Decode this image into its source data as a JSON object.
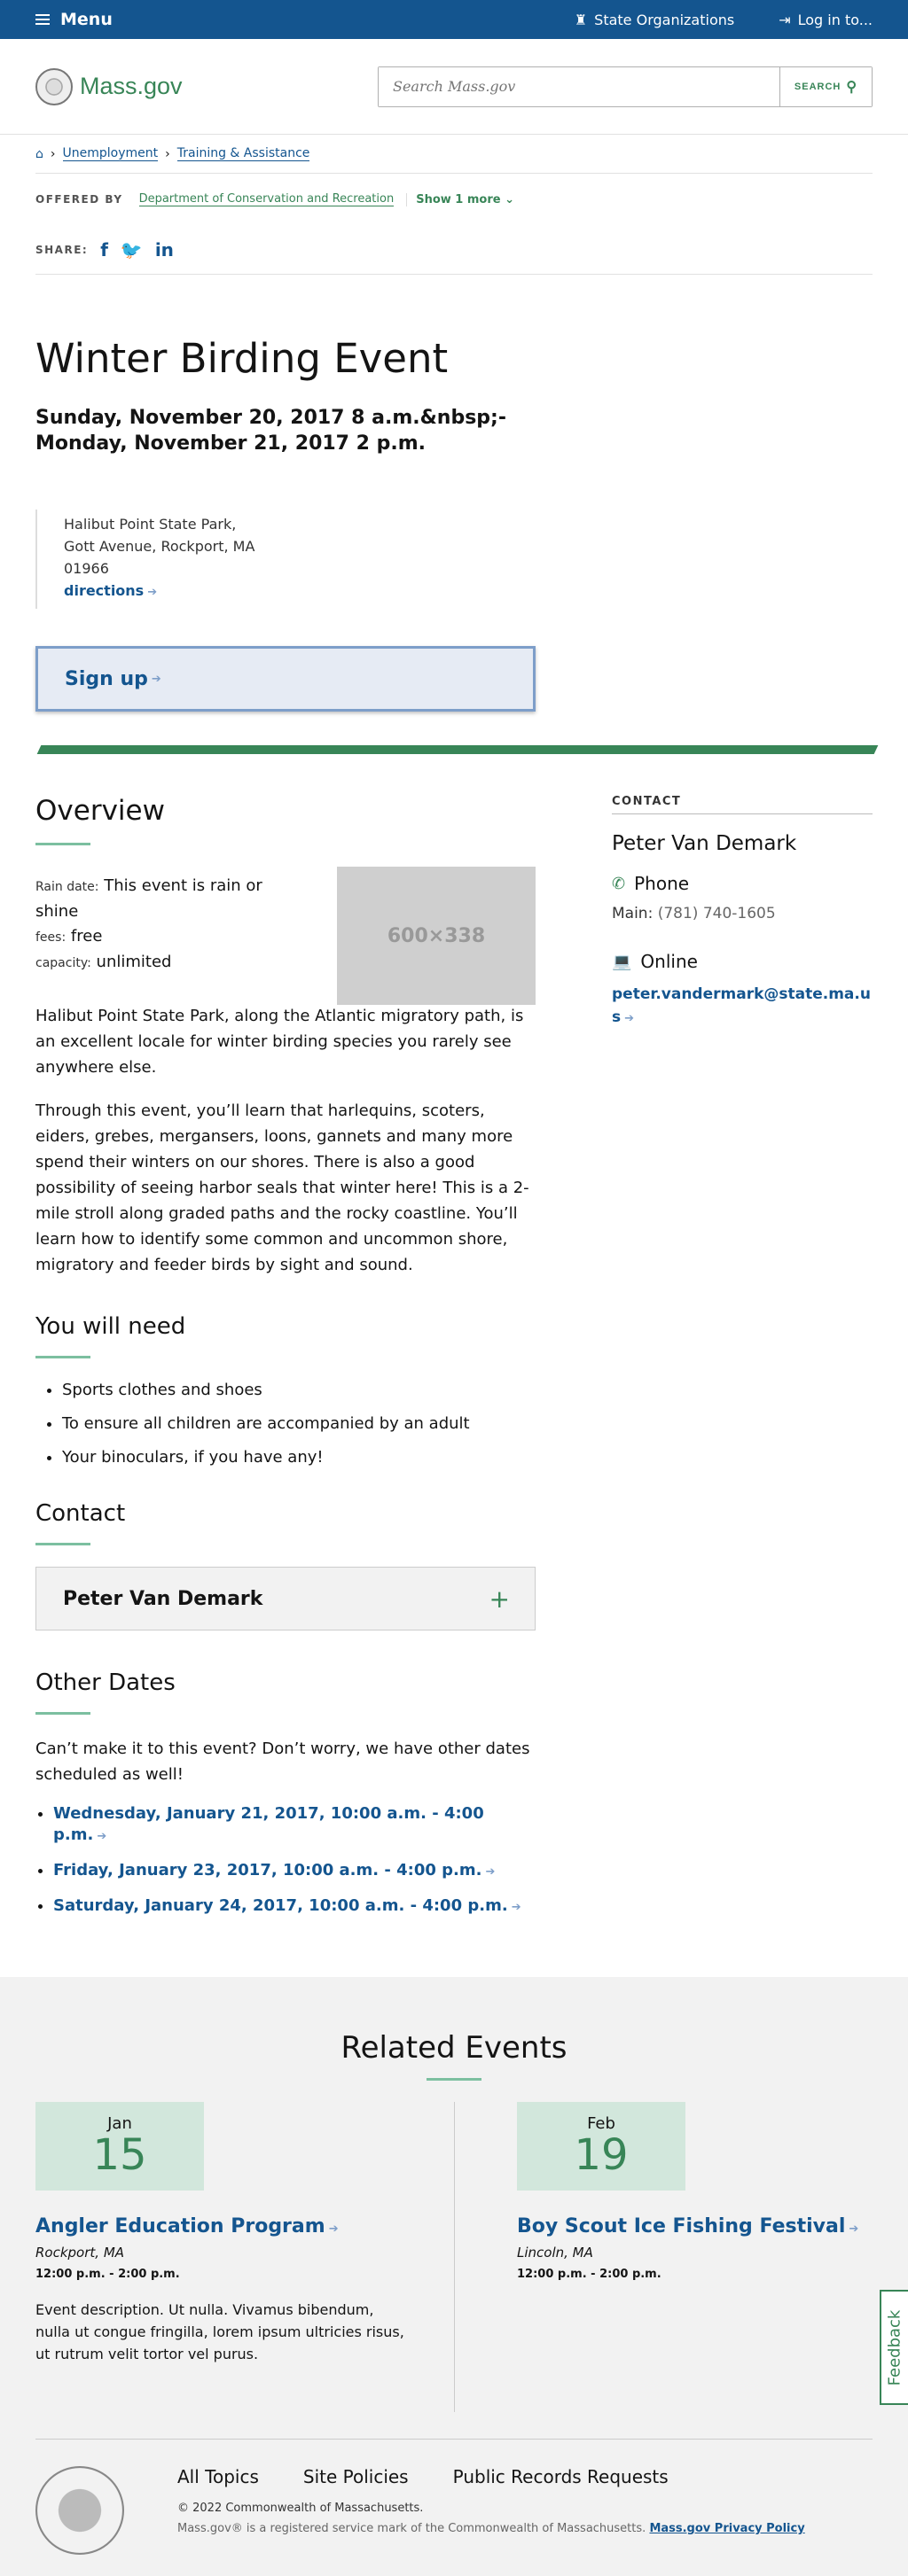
{
  "topbar": {
    "menu_label": "Menu",
    "state_orgs_label": "State Organizations",
    "login_label": "Log in to..."
  },
  "header": {
    "logo_text": "Mass.gov",
    "search_placeholder": "Search Mass.gov",
    "search_button": "SEARCH"
  },
  "breadcrumb": {
    "items": [
      "Unemployment",
      "Training & Assistance"
    ]
  },
  "offered_by": {
    "label": "OFFERED BY",
    "department": "Department of Conservation and Recreation",
    "more": "Show 1 more"
  },
  "share": {
    "label": "SHARE:"
  },
  "event": {
    "title": "Winter Birding Event",
    "dates_line1": "Sunday, November 20, 2017 8 a.m.&nbsp;-",
    "dates_line2": "Monday, November 21, 2017 2 p.m.",
    "address_line1": "Halibut Point State Park,",
    "address_line2": "Gott Avenue, Rockport, MA",
    "address_line3": "01966",
    "directions_label": "directions",
    "signup_label": "Sign up"
  },
  "overview": {
    "heading": "Overview",
    "rain_key": "Rain date:",
    "rain_val": "This event is rain or shine",
    "fees_key": "fees:",
    "fees_val": "free",
    "capacity_key": "capacity:",
    "capacity_val": "unlimited",
    "image_placeholder": "600×338",
    "para1": "Halibut Point State Park, along the Atlantic migratory path, is an excellent locale for winter birding species you rarely see anywhere else.",
    "para2": "Through this event, you’ll learn that harlequins, scoters, eiders, grebes, mergansers, loons, gannets and many more spend their winters on our shores. There is also a good possibility of seeing harbor seals that winter here! This is a 2-mile stroll along graded paths and the rocky coastline. You’ll learn how to identify some common and uncommon shore, migratory and feeder birds by sight and sound."
  },
  "needs": {
    "heading": "You will need",
    "items": [
      "Sports clothes and shoes",
      "To ensure all children are accompanied by an adult",
      "Your binoculars, if you have any!"
    ]
  },
  "contact_section": {
    "heading": "Contact",
    "accordion_label": "Peter Van Demark"
  },
  "other_dates": {
    "heading": "Other Dates",
    "intro": "Can’t make it to this event? Don’t worry, we have other dates scheduled as well!",
    "items": [
      "Wednesday, January 21, 2017, 10:00 a.m. - 4:00 p.m.",
      "Friday, January 23, 2017, 10:00 a.m. - 4:00 p.m.",
      "Saturday, January 24, 2017, 10:00 a.m. - 4:00 p.m."
    ]
  },
  "sidebar_contact": {
    "label": "CONTACT",
    "name": "Peter Van Demark",
    "phone_heading": "Phone",
    "phone_prefix": "Main:",
    "phone_number": "(781) 740-1605",
    "online_heading": "Online",
    "email": "peter.vandermark@state.ma.us"
  },
  "related": {
    "heading": "Related Events",
    "events": [
      {
        "month": "Jan",
        "day": "15",
        "title": "Angler Education Program",
        "place": "Rockport, MA",
        "time": "12:00 p.m. - 2:00 p.m.",
        "desc": "Event description. Ut nulla. Vivamus bibendum, nulla ut congue fringilla, lorem ipsum ultricies risus, ut rutrum velit tortor vel purus."
      },
      {
        "month": "Feb",
        "day": "19",
        "title": "Boy Scout Ice Fishing Festival",
        "place": "Lincoln, MA",
        "time": "12:00 p.m. - 2:00 p.m."
      }
    ]
  },
  "feedback_label": "Feedback",
  "footer": {
    "links": [
      "All Topics",
      "Site Policies",
      "Public Records Requests"
    ],
    "copyright": "© 2022 Commonwealth of Massachusetts.",
    "mark_text": "Mass.gov® is a registered service mark of the Commonwealth of Massachusetts.",
    "privacy_link": "Mass.gov Privacy Policy"
  },
  "colors": {
    "blue": "#14558f",
    "green": "#388557",
    "light_green": "#d2e7dc",
    "gray_bg": "#f2f2f2"
  }
}
